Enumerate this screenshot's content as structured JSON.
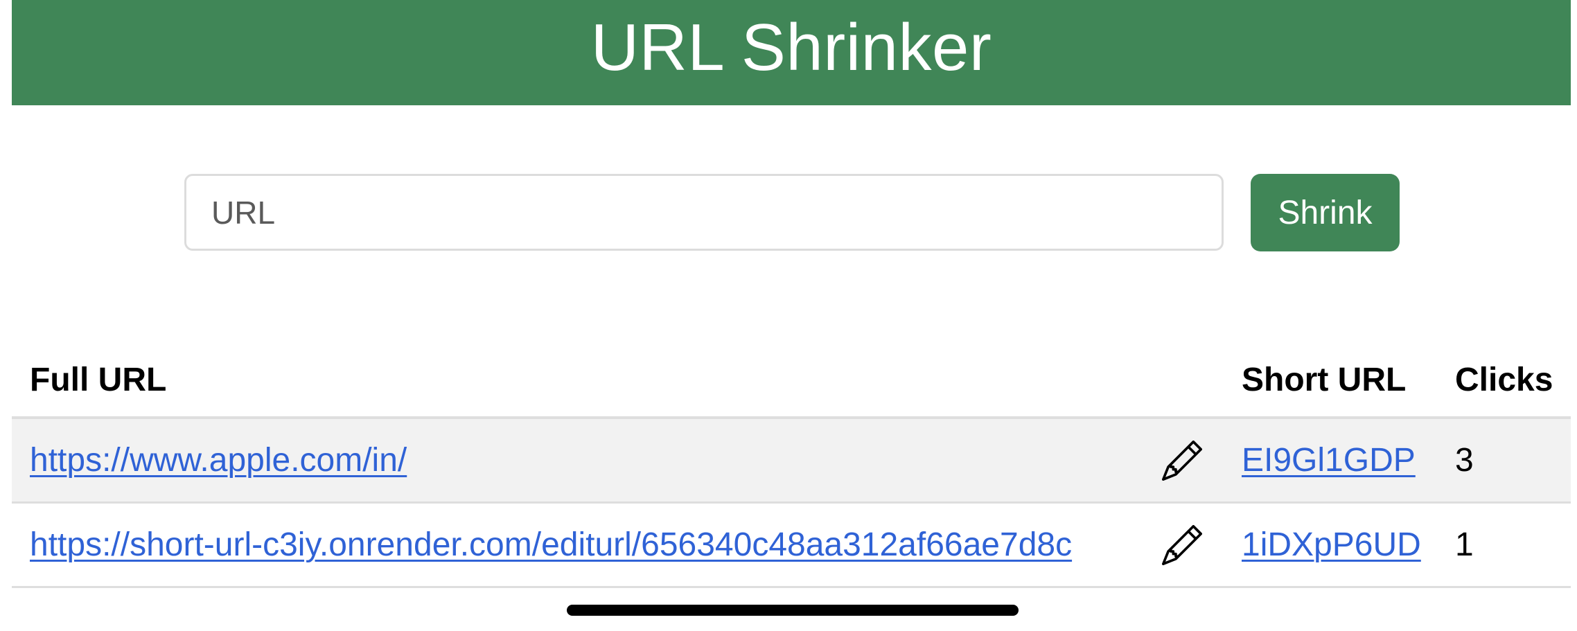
{
  "header": {
    "title": "URL Shrinker"
  },
  "form": {
    "url_placeholder": "URL",
    "url_value": "",
    "submit_label": "Shrink"
  },
  "table": {
    "columns": [
      "Full URL",
      "",
      "Short URL",
      "Clicks"
    ],
    "rows": [
      {
        "full_url": "https://www.apple.com/in/",
        "edit_icon": "pencil-icon",
        "short_url": "EI9Gl1GDP",
        "clicks": "3"
      },
      {
        "full_url": "https://short-url-c3iy.onrender.com/editurl/656340c48aa312af66ae7d8c",
        "edit_icon": "pencil-icon",
        "short_url": "1iDXpP6UD",
        "clicks": "1"
      }
    ]
  },
  "colors": {
    "brand_green": "#408657",
    "link_blue": "#2f62d6",
    "stripe_gray": "#f2f2f2"
  }
}
